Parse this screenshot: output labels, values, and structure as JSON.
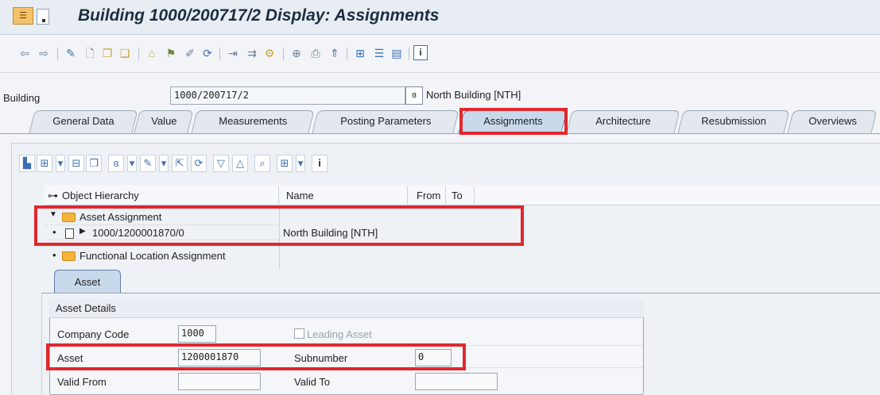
{
  "window": {
    "title": "Building 1000/200717/2 Display: Assignments"
  },
  "header": {
    "building_label": "Building",
    "building_value": "1000/200717/2",
    "building_description": "North Building [NTH]"
  },
  "tabs": [
    {
      "label": "General Data"
    },
    {
      "label": "Value"
    },
    {
      "label": "Measurements"
    },
    {
      "label": "Posting Parameters"
    },
    {
      "label": "Assignments"
    },
    {
      "label": "Architecture"
    },
    {
      "label": "Resubmission"
    },
    {
      "label": "Overviews"
    }
  ],
  "tree": {
    "columns": [
      "Object Hierarchy",
      "Name",
      "From",
      "To"
    ],
    "rows": [
      {
        "label": "Asset Assignment",
        "name": ""
      },
      {
        "label": "1000/1200001870/0",
        "name": "North Building [NTH]"
      },
      {
        "label": "Functional Location Assignment",
        "name": ""
      }
    ]
  },
  "asset_tab": {
    "label": "Asset"
  },
  "asset_details": {
    "title": "Asset Details",
    "company_code_label": "Company Code",
    "company_code_value": "1000",
    "leading_asset_label": "Leading Asset",
    "asset_label": "Asset",
    "asset_value": "1200001870",
    "subnumber_label": "Subnumber",
    "subnumber_value": "0",
    "valid_from_label": "Valid From",
    "valid_from_value": "",
    "valid_to_label": "Valid To",
    "valid_to_value": ""
  },
  "colors": {
    "highlight": "#e0282e",
    "active_tab": "#c9d9ec"
  }
}
